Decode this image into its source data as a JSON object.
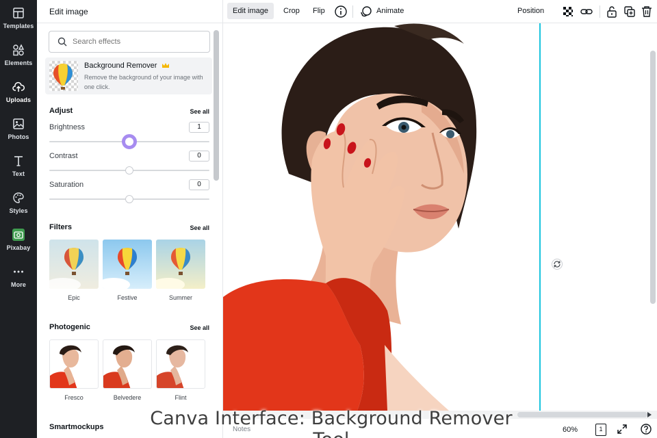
{
  "rail": {
    "items": [
      {
        "label": "Templates",
        "icon": "templates-icon"
      },
      {
        "label": "Elements",
        "icon": "shapes-icon"
      },
      {
        "label": "Uploads",
        "icon": "upload-cloud-icon"
      },
      {
        "label": "Photos",
        "icon": "image-icon"
      },
      {
        "label": "Text",
        "icon": "text-icon"
      },
      {
        "label": "Styles",
        "icon": "palette-icon"
      },
      {
        "label": "Pixabay",
        "icon": "pixabay-icon"
      },
      {
        "label": "More",
        "icon": "more-dots-icon"
      }
    ],
    "active": "Uploads"
  },
  "panel": {
    "title": "Edit image",
    "search_placeholder": "Search effects",
    "background_remover": {
      "title": "Background Remover",
      "description": "Remove the background of your image with one click."
    },
    "adjust": {
      "title": "Adjust",
      "see_all": "See all",
      "sliders": [
        {
          "label": "Brightness",
          "value": "1",
          "level": 0.5
        },
        {
          "label": "Contrast",
          "value": "0",
          "level": 0.5
        },
        {
          "label": "Saturation",
          "value": "0",
          "level": 0.5
        }
      ]
    },
    "filters": {
      "title": "Filters",
      "see_all": "See all",
      "items": [
        "Epic",
        "Festive",
        "Summer"
      ]
    },
    "photogenic": {
      "title": "Photogenic",
      "see_all": "See all",
      "items": [
        "Fresco",
        "Belvedere",
        "Flint"
      ]
    },
    "smartmockups": {
      "title": "Smartmockups"
    }
  },
  "toolbar": {
    "edit_image": "Edit image",
    "crop": "Crop",
    "flip": "Flip",
    "animate": "Animate",
    "position": "Position"
  },
  "bottom": {
    "notes": "Notes",
    "zoom": "60%",
    "page_number": "1"
  },
  "caption": "Canva Interface: Background Remover Tool",
  "colors": {
    "rail_bg": "#1e2024",
    "guide": "#19c4de",
    "slider_active": "#a78cf0",
    "shirt": "#e2361a"
  }
}
